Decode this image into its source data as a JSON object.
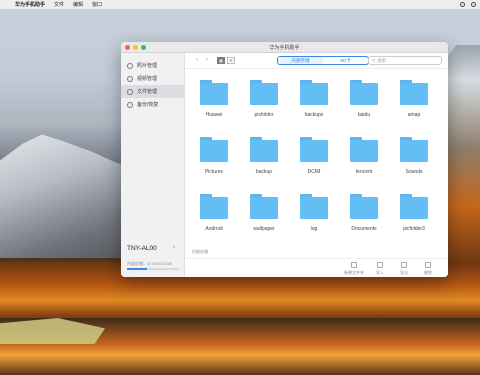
{
  "menubar": {
    "apple": "",
    "app_name": "华为手机助手",
    "items": [
      "文件",
      "编辑",
      "窗口"
    ]
  },
  "window": {
    "title": "华为手机助手",
    "traffic_lights": {
      "close": "#fc5f57",
      "minimize": "#fdbc2e",
      "zoom": "#28c840"
    }
  },
  "sidebar": {
    "items": [
      {
        "label": "照片管理",
        "icon": "photo-icon"
      },
      {
        "label": "视频管理",
        "icon": "video-icon"
      },
      {
        "label": "文件管理",
        "icon": "file-icon"
      },
      {
        "label": "备份/恢复",
        "icon": "backup-icon"
      }
    ],
    "active_index": 2,
    "device_name": "TNY-AL00",
    "device_chevron": "›",
    "storage_text": "内部存储：37.00/75.0GB",
    "storage_fraction": 0.38
  },
  "toolbar": {
    "back": "‹",
    "forward": "›",
    "view_grid": "▦",
    "view_list": "☰",
    "tabs": [
      "内部存储",
      "SD卡"
    ],
    "search_placeholder": "搜索"
  },
  "folders": [
    "Huawei",
    "picfolder",
    "backups",
    "baidu",
    "amap",
    "Pictures",
    "backup",
    "DCIM",
    "tencent",
    "Sounds",
    "Android",
    "wallpaper",
    "log",
    "Documents",
    "picfolder3"
  ],
  "status_text": "内部存储",
  "bottom_actions": [
    "新建文件夹",
    "导入",
    "导出",
    "删除"
  ],
  "colors": {
    "accent": "#3a88e6",
    "folder": "#63bef3"
  }
}
